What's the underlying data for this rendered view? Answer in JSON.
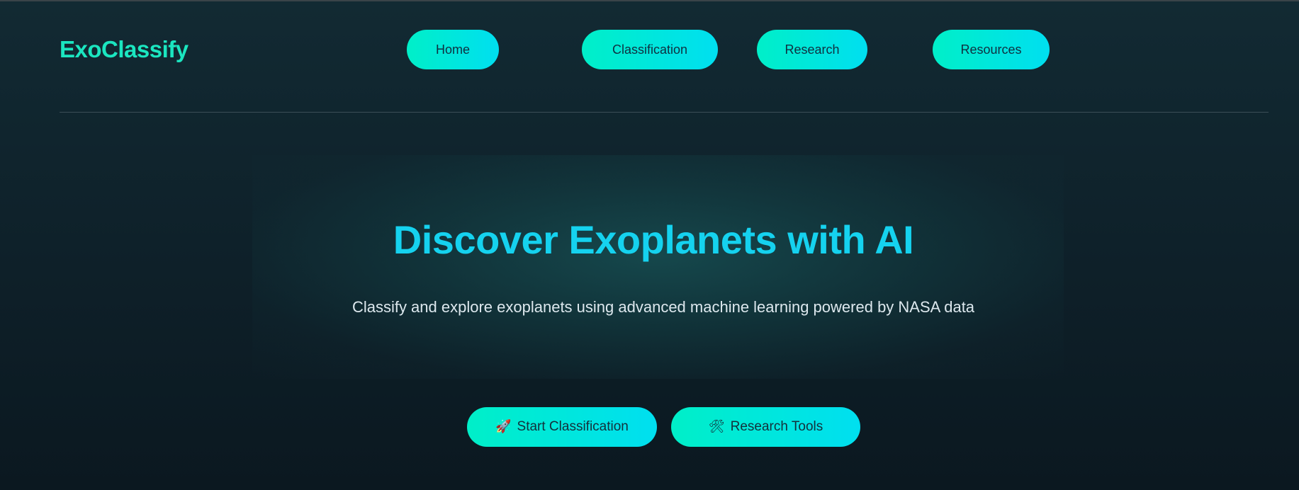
{
  "brand": {
    "name": "ExoClassify",
    "color": "#1be6c0"
  },
  "nav": {
    "items": [
      {
        "label": "Home"
      },
      {
        "label": "Classification"
      },
      {
        "label": "Research"
      },
      {
        "label": "Resources"
      }
    ]
  },
  "hero": {
    "title": "Discover Exoplanets with AI",
    "subtitle": "Classify and explore exoplanets using advanced machine learning powered by NASA data"
  },
  "actions": {
    "start": {
      "icon": "rocket-icon",
      "glyph": "🚀",
      "label": "Start Classification"
    },
    "research": {
      "icon": "tools-icon",
      "glyph": "🛠",
      "label": "Research Tools"
    }
  },
  "colors": {
    "accent_start": "#00efc8",
    "accent_end": "#00dff0",
    "title": "#15d2ef",
    "background": "#0e2029"
  }
}
